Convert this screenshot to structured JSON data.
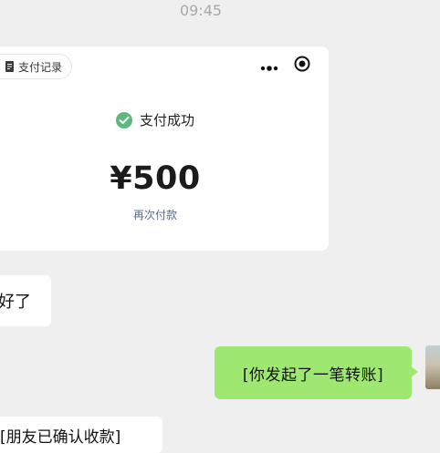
{
  "chat": {
    "timestamp": "09:45",
    "payment_card": {
      "records_label": "支付记录",
      "status": "支付成功",
      "amount": "¥500",
      "repay_label": "再次付款"
    },
    "messages": {
      "left_reply": "好了",
      "right_transfer": "[你发起了一笔转账]",
      "left_confirm": "[朋友已确认收款]"
    }
  },
  "colors": {
    "background": "#efefef",
    "card": "#ffffff",
    "success_green": "#5cb87c",
    "sent_bubble": "#9ee871",
    "link_blue": "#5a6b8c"
  },
  "icons": [
    "document-icon",
    "more-icon",
    "target-icon",
    "check-icon"
  ]
}
